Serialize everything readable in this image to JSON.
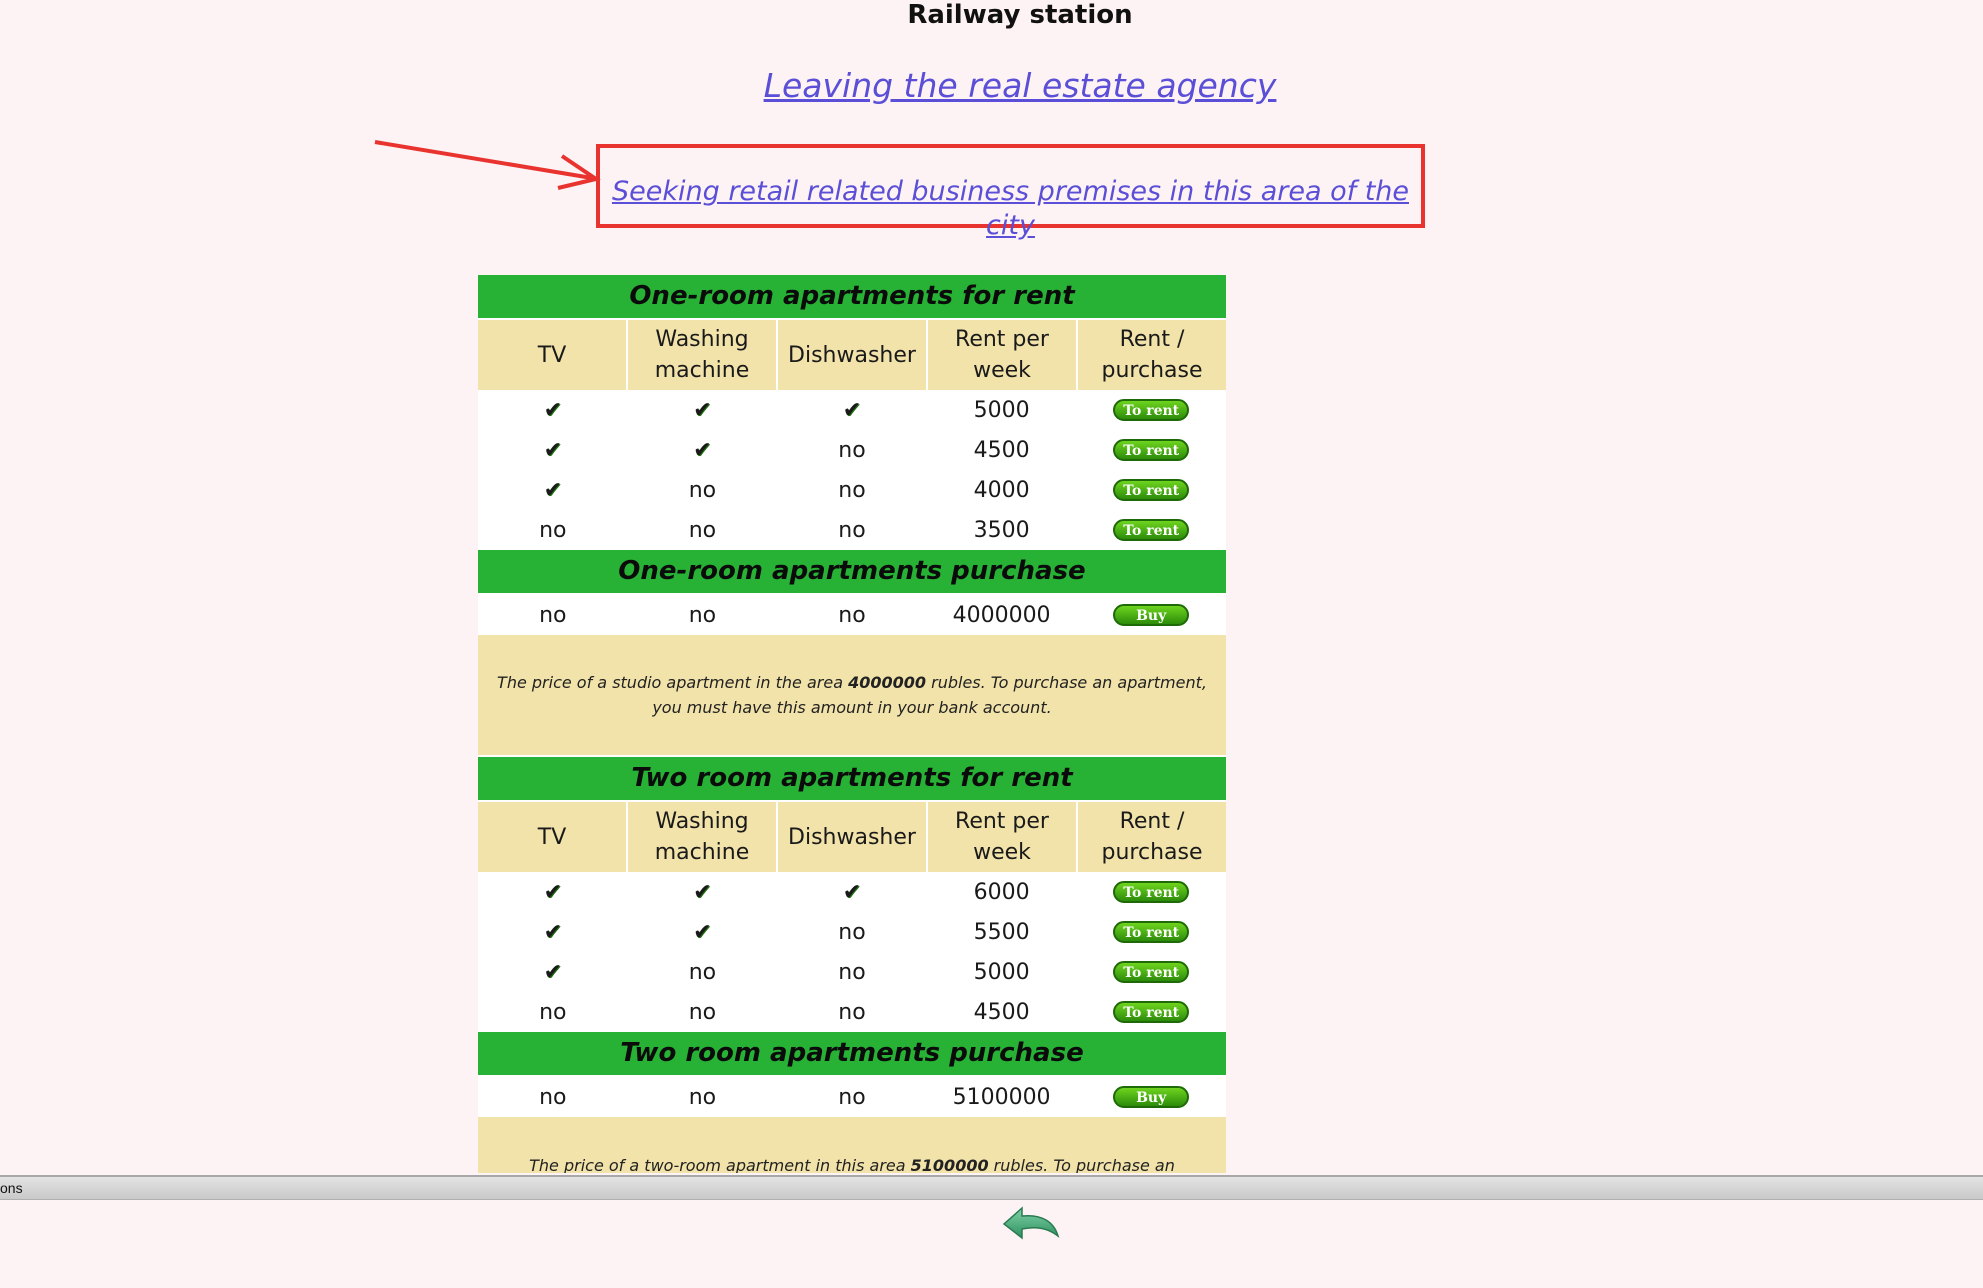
{
  "page": {
    "title": "Railway station",
    "leave_link": "Leaving the real estate agency",
    "seek_link": "Seeking retail related business premises in this area of the city"
  },
  "columns": [
    "TV",
    "Washing\nmachine",
    "Dishwasher",
    "Rent per\nweek",
    "Rent /\npurchase"
  ],
  "rent_button": "To rent",
  "buy_button": "Buy",
  "sections": {
    "one_rent": {
      "title": "One-room apartments for rent",
      "rows": [
        {
          "tv": "✔",
          "washing": "✔",
          "dish": "✔",
          "price": "5000"
        },
        {
          "tv": "✔",
          "washing": "✔",
          "dish": "no",
          "price": "4500"
        },
        {
          "tv": "✔",
          "washing": "no",
          "dish": "no",
          "price": "4000"
        },
        {
          "tv": "no",
          "washing": "no",
          "dish": "no",
          "price": "3500"
        }
      ]
    },
    "one_buy": {
      "title": "One-room apartments purchase",
      "row": {
        "tv": "no",
        "washing": "no",
        "dish": "no",
        "price": "4000000"
      },
      "info_pre": "The price of a studio apartment in the area ",
      "info_amount": "4000000",
      "info_post": "  rubles. To purchase an apartment, you must have this amount in your bank account."
    },
    "two_rent": {
      "title": "Two room apartments for rent",
      "rows": [
        {
          "tv": "✔",
          "washing": "✔",
          "dish": "✔",
          "price": "6000"
        },
        {
          "tv": "✔",
          "washing": "✔",
          "dish": "no",
          "price": "5500"
        },
        {
          "tv": "✔",
          "washing": "no",
          "dish": "no",
          "price": "5000"
        },
        {
          "tv": "no",
          "washing": "no",
          "dish": "no",
          "price": "4500"
        }
      ]
    },
    "two_buy": {
      "title": "Two room apartments purchase",
      "row": {
        "tv": "no",
        "washing": "no",
        "dish": "no",
        "price": "5100000"
      },
      "info_pre": "The price of a two-room apartment in this area ",
      "info_amount": "5100000",
      "info_post": " rubles. To purchase an apartment"
    }
  },
  "statusbar": {
    "text": "ons"
  },
  "icons": {
    "check": "check-icon",
    "back": "back-arrow-icon"
  },
  "colors": {
    "header_green": "#27b235",
    "header_beige": "#f2e3aa",
    "link": "#5a4fd6",
    "highlight": "#e8332e",
    "background": "#fdf3f4"
  }
}
